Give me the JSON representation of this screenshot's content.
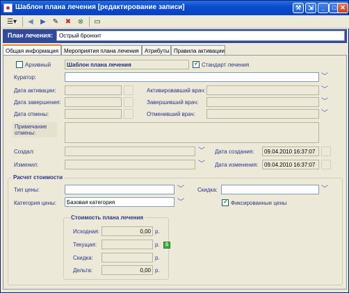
{
  "window": {
    "title": "Шаблон плана лечения [редактирование записи]",
    "controls": [
      "tool-icon",
      "restore-icon",
      "minimize-icon",
      "maximize-icon",
      "close-icon"
    ]
  },
  "toolbar": {
    "icons": [
      "dropdown-menu-icon",
      "back-arrow-icon",
      "forward-arrow-icon",
      "edit-pen-icon",
      "delete-icon",
      "cancel-icon",
      "properties-icon"
    ]
  },
  "plan": {
    "label": "План лечения:",
    "value": "Острый бронхит"
  },
  "tabs": [
    {
      "label": "Общая информация",
      "active": true
    },
    {
      "label": "Мероприятия плана лечения",
      "active": false
    },
    {
      "label": "Атрибуты",
      "active": false
    },
    {
      "label": "Правила активации",
      "active": false
    }
  ],
  "general": {
    "archive_label": "Архивный",
    "archive_checked": false,
    "template_label": "Шаблон плана лечения",
    "standard_label": "Стандарт лечения",
    "standard_checked": true,
    "curator_label": "Куратор:",
    "activation_date_label": "Дата активации:",
    "activating_doctor_label": "Активировавший врач:",
    "completion_date_label": "Дата завершения:",
    "completing_doctor_label": "Завершивший врач:",
    "cancel_date_label": "Дата отмены:",
    "cancelling_doctor_label": "Отменивший врач:",
    "cancel_note_label": "Примечание отмены:",
    "created_by_label": "Создал:",
    "created_date_label": "Дата создания:",
    "created_date_value": "09.04.2010 16:37:07",
    "modified_by_label": "Изменил:",
    "modified_date_label": "Дата изменения:",
    "modified_date_value": "09.04.2010 16:37:07"
  },
  "pricing": {
    "title": "Расчет стоимости",
    "price_type_label": "Тип цены:",
    "discount_label": "Скидка:",
    "price_category_label": "Категория цены:",
    "price_category_value": "Базовая категория",
    "fixed_prices_label": "Фиксированные цены",
    "fixed_prices_checked": true,
    "cost": {
      "title": "Стоимость плана лечения",
      "initial_label": "Исходная:",
      "initial_value": "0,00",
      "current_label": "Текущая:",
      "current_value": "",
      "discount_label": "Скидка:",
      "discount_value": "",
      "delta_label": "Дельта:",
      "delta_value": "0,00",
      "currency": "р."
    }
  }
}
